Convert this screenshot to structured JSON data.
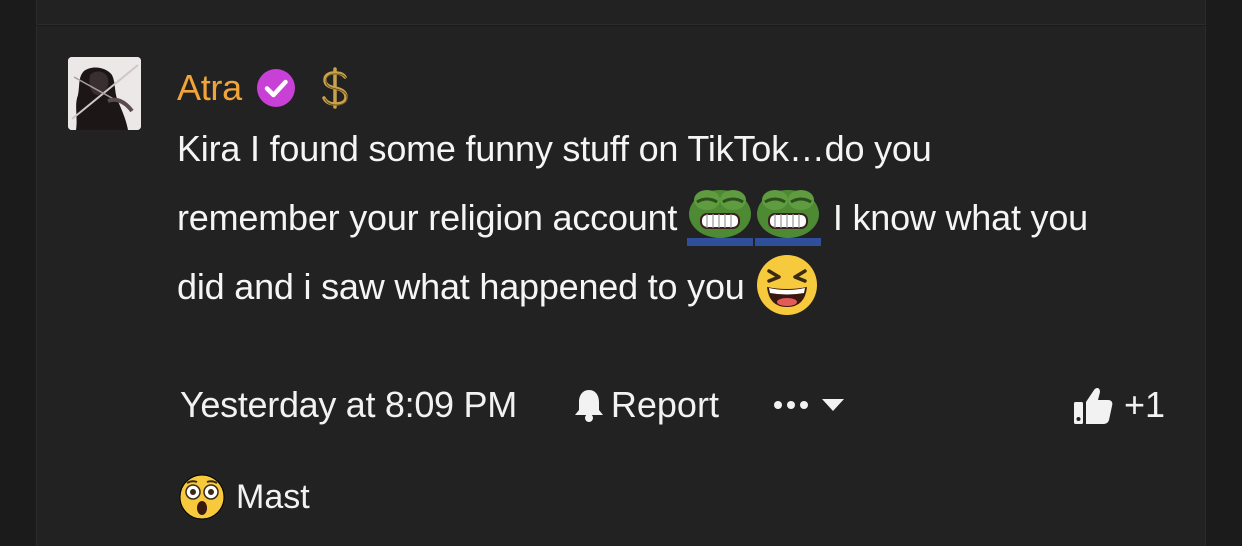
{
  "post": {
    "author": "Atra",
    "badges": [
      "verified-check-icon",
      "dollar-sign-icon"
    ],
    "message": {
      "line1": "Kira I found some funny stuff on TikTok…do you",
      "line2a": "remember your religion account",
      "line2b": "I know what you",
      "line3": "did and i saw what happened to you"
    },
    "inline_emojis": [
      "pepe-grin-emoji",
      "pepe-grin-emoji",
      "grinning-squinting-face-emoji"
    ]
  },
  "meta": {
    "timestamp": "Yesterday at 8:09 PM",
    "report_label": "Report",
    "like_count": "+1"
  },
  "reaction": {
    "emoji": "astonished-face-emoji",
    "label": "Mast"
  },
  "colors": {
    "background": "#1b1b1b",
    "panel": "#222222",
    "author": "#f0a43a",
    "verified_badge": "#c840d6",
    "text": "#f5f5f5"
  }
}
